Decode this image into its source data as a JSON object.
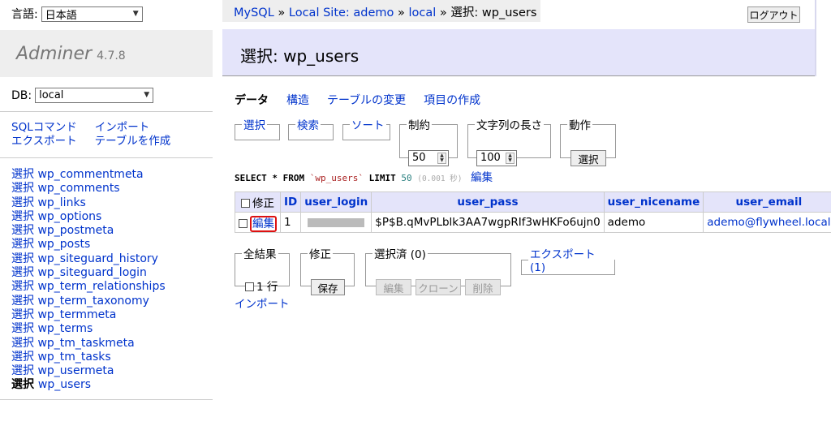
{
  "sidebar": {
    "lang_label": "言語:",
    "lang_value": "日本語",
    "logo": "Adminer",
    "version": "4.7.8",
    "db_label": "DB:",
    "db_value": "local",
    "links": {
      "sql": "SQLコマンド",
      "import": "インポート",
      "export": "エクスポート",
      "create_table": "テーブルを作成"
    },
    "select_prefix": "選択",
    "tables": [
      "wp_commentmeta",
      "wp_comments",
      "wp_links",
      "wp_options",
      "wp_postmeta",
      "wp_posts",
      "wp_siteguard_history",
      "wp_siteguard_login",
      "wp_term_relationships",
      "wp_term_taxonomy",
      "wp_termmeta",
      "wp_terms",
      "wp_tm_taskmeta",
      "wp_tm_tasks",
      "wp_usermeta",
      "wp_users"
    ],
    "current_table": "wp_users"
  },
  "breadcrumb": {
    "mysql": "MySQL",
    "site": "Local Site: ademo",
    "db": "local",
    "sep": "»",
    "current": "選択: wp_users"
  },
  "logout": "ログアウト",
  "title": "選択: wp_users",
  "subnav": {
    "data": "データ",
    "structure": "構造",
    "alter": "テーブルの変更",
    "new_item": "項目の作成"
  },
  "filters": {
    "select": "選択",
    "search": "検索",
    "sort": "ソート",
    "limit_label": "制約",
    "limit_value": "50",
    "text_length_label": "文字列の長さ",
    "text_length_value": "100",
    "action_label": "動作",
    "action_button": "選択"
  },
  "query": {
    "select": "SELECT",
    "star": "*",
    "from": "FROM",
    "table": "`wp_users`",
    "limit": "LIMIT",
    "limit_value": "50",
    "time": "(0.001 秒)",
    "edit": "編集"
  },
  "table": {
    "headers": {
      "check": "修正",
      "id": "ID",
      "user_login": "user_login",
      "user_pass": "user_pass",
      "user_nicename": "user_nicename",
      "user_email": "user_email"
    },
    "rows": [
      {
        "edit": "編集",
        "id": "1",
        "user_pass": "$P$B.qMvPLblk3AA7wgpRIf3wHKFo6ujn0",
        "user_nicename": "ademo",
        "user_email": "ademo@flywheel.local"
      }
    ]
  },
  "footer_panels": {
    "all_results_label": "全結果",
    "row_count": "1 行",
    "modify_label": "修正",
    "save_button": "保存",
    "selected_label": "選択済 (0)",
    "edit_button": "編集",
    "clone_button": "クローン",
    "delete_button": "削除",
    "export_link": "エクスポート (1)"
  },
  "import_link": "インポート"
}
